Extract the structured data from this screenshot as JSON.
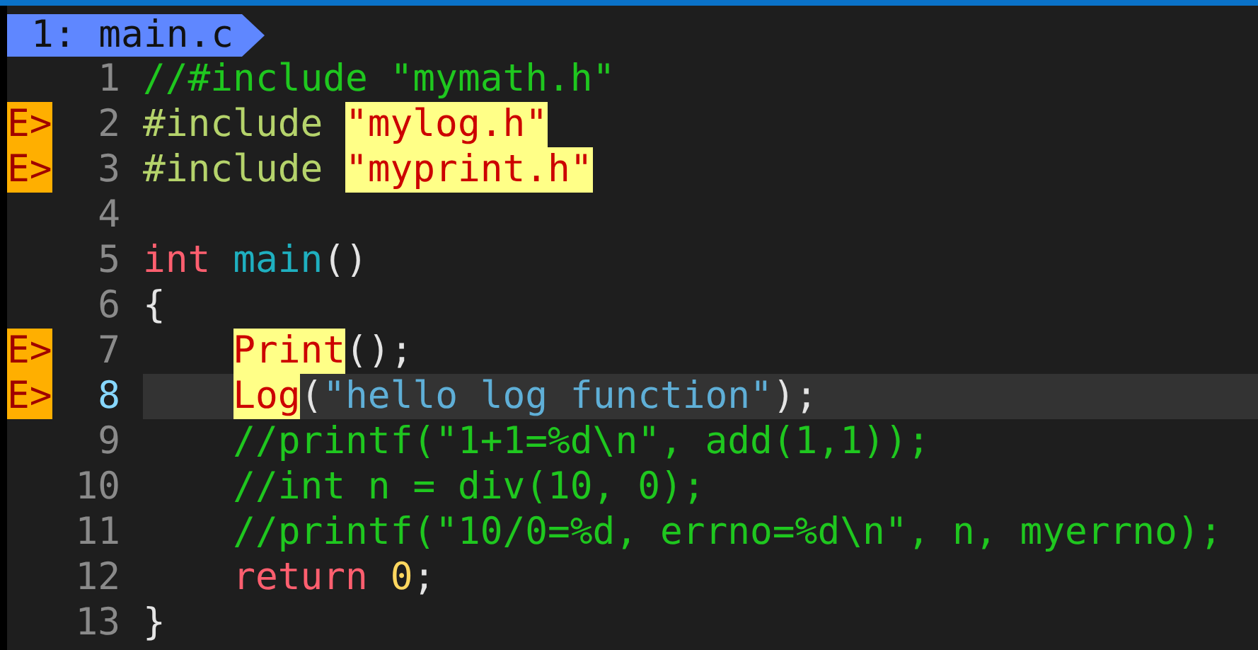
{
  "tab": {
    "label": "1: main.c",
    "selected": true
  },
  "lines": [
    {
      "number": "1",
      "current": false,
      "indented": false,
      "tokens": [
        {
          "text": "//#include \"mymath.h\"",
          "kind": "comment"
        }
      ]
    },
    {
      "number": "2",
      "sign": "E>",
      "current": false,
      "indented": false,
      "tokens": [
        {
          "text": "#include ",
          "kind": "preproc"
        },
        {
          "text": "\"mylog.h\"",
          "kind": "error"
        }
      ]
    },
    {
      "number": "3",
      "sign": "E>",
      "current": false,
      "indented": false,
      "tokens": [
        {
          "text": "#include ",
          "kind": "preproc"
        },
        {
          "text": "\"myprint.h\"",
          "kind": "error"
        }
      ]
    },
    {
      "number": "4",
      "current": false,
      "indented": false
    },
    {
      "number": "5",
      "current": false,
      "indented": false,
      "tokens": [
        {
          "text": "int ",
          "kind": "keyword"
        },
        {
          "text": "main",
          "kind": "function"
        },
        {
          "text": "()",
          "kind": "plain"
        }
      ]
    },
    {
      "number": "6",
      "current": false,
      "indented": false,
      "tokens": [
        {
          "text": "{",
          "kind": "plain"
        }
      ]
    },
    {
      "number": "7",
      "sign": "E>",
      "current": false,
      "indented": true,
      "tokens": [
        {
          "text": "Print",
          "kind": "error"
        },
        {
          "text": "();",
          "kind": "plain"
        }
      ]
    },
    {
      "number": "8",
      "sign": "E>",
      "current": true,
      "indented": true,
      "tokens": [
        {
          "text": "Log",
          "kind": "error"
        },
        {
          "text": "(",
          "kind": "plain"
        },
        {
          "text": "\"hello log function\"",
          "kind": "string"
        },
        {
          "text": ");",
          "kind": "plain"
        }
      ]
    },
    {
      "number": "9",
      "current": false,
      "indented": true,
      "tokens": [
        {
          "text": "//printf(\"1+1=%d\\n\", add(1,1));",
          "kind": "comment"
        }
      ]
    },
    {
      "number": "10",
      "current": false,
      "indented": true,
      "tokens": [
        {
          "text": "//int n = div(10, 0);",
          "kind": "comment"
        }
      ]
    },
    {
      "number": "11",
      "current": false,
      "indented": true,
      "tokens": [
        {
          "text": "//printf(\"10/0=%d, errno=%d\\n\", n, myerrno);",
          "kind": "comment"
        }
      ]
    },
    {
      "number": "12",
      "current": false,
      "indented": true,
      "tokens": [
        {
          "text": "return ",
          "kind": "keyword"
        },
        {
          "text": "0",
          "kind": "number"
        },
        {
          "text": ";",
          "kind": "plain"
        }
      ]
    },
    {
      "number": "13",
      "current": false,
      "indented": false,
      "tokens": [
        {
          "text": "}",
          "kind": "plain"
        }
      ]
    }
  ]
}
